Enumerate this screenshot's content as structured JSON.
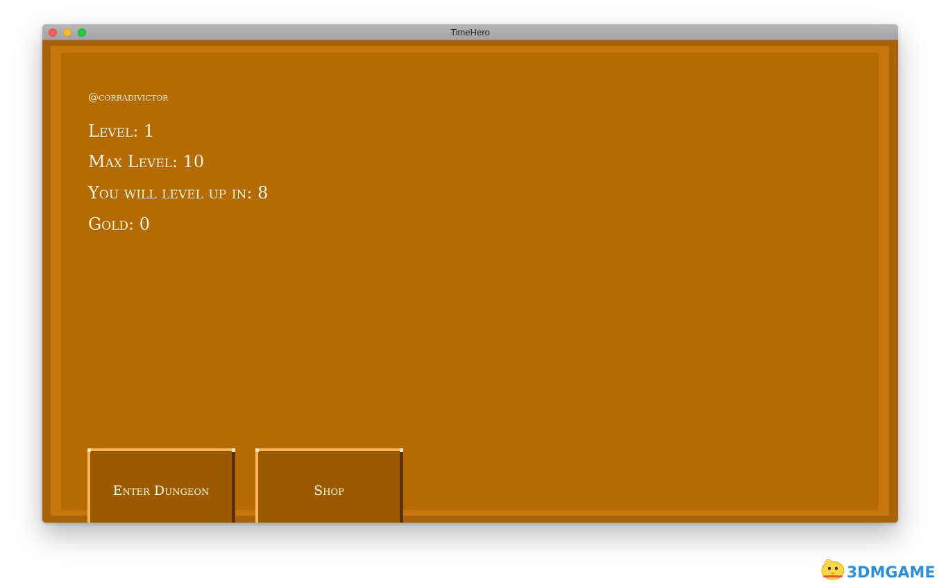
{
  "window": {
    "title": "TimeHero"
  },
  "player": {
    "username": "@corradivictor",
    "level_text": "Level: 1",
    "max_level_text": "Max Level: 10",
    "level_up_text": "You will level up in: 8",
    "gold_text": "Gold: 0"
  },
  "buttons": {
    "enter_dungeon": "Enter Dungeon",
    "shop": "Shop"
  },
  "watermark": {
    "text": "3DMGAME"
  },
  "colors": {
    "panel": "#b66b00",
    "frame": "#c7760c",
    "button": "#9b5a00",
    "button_highlight": "#ffb457",
    "button_shadow": "#5c3200",
    "text": "#fff7e8"
  },
  "icons": {
    "close": "close-traffic-light-icon",
    "minimize": "minimize-traffic-light-icon",
    "maximize": "maximize-traffic-light-icon",
    "watermark_logo": "bird-mascot-icon"
  }
}
